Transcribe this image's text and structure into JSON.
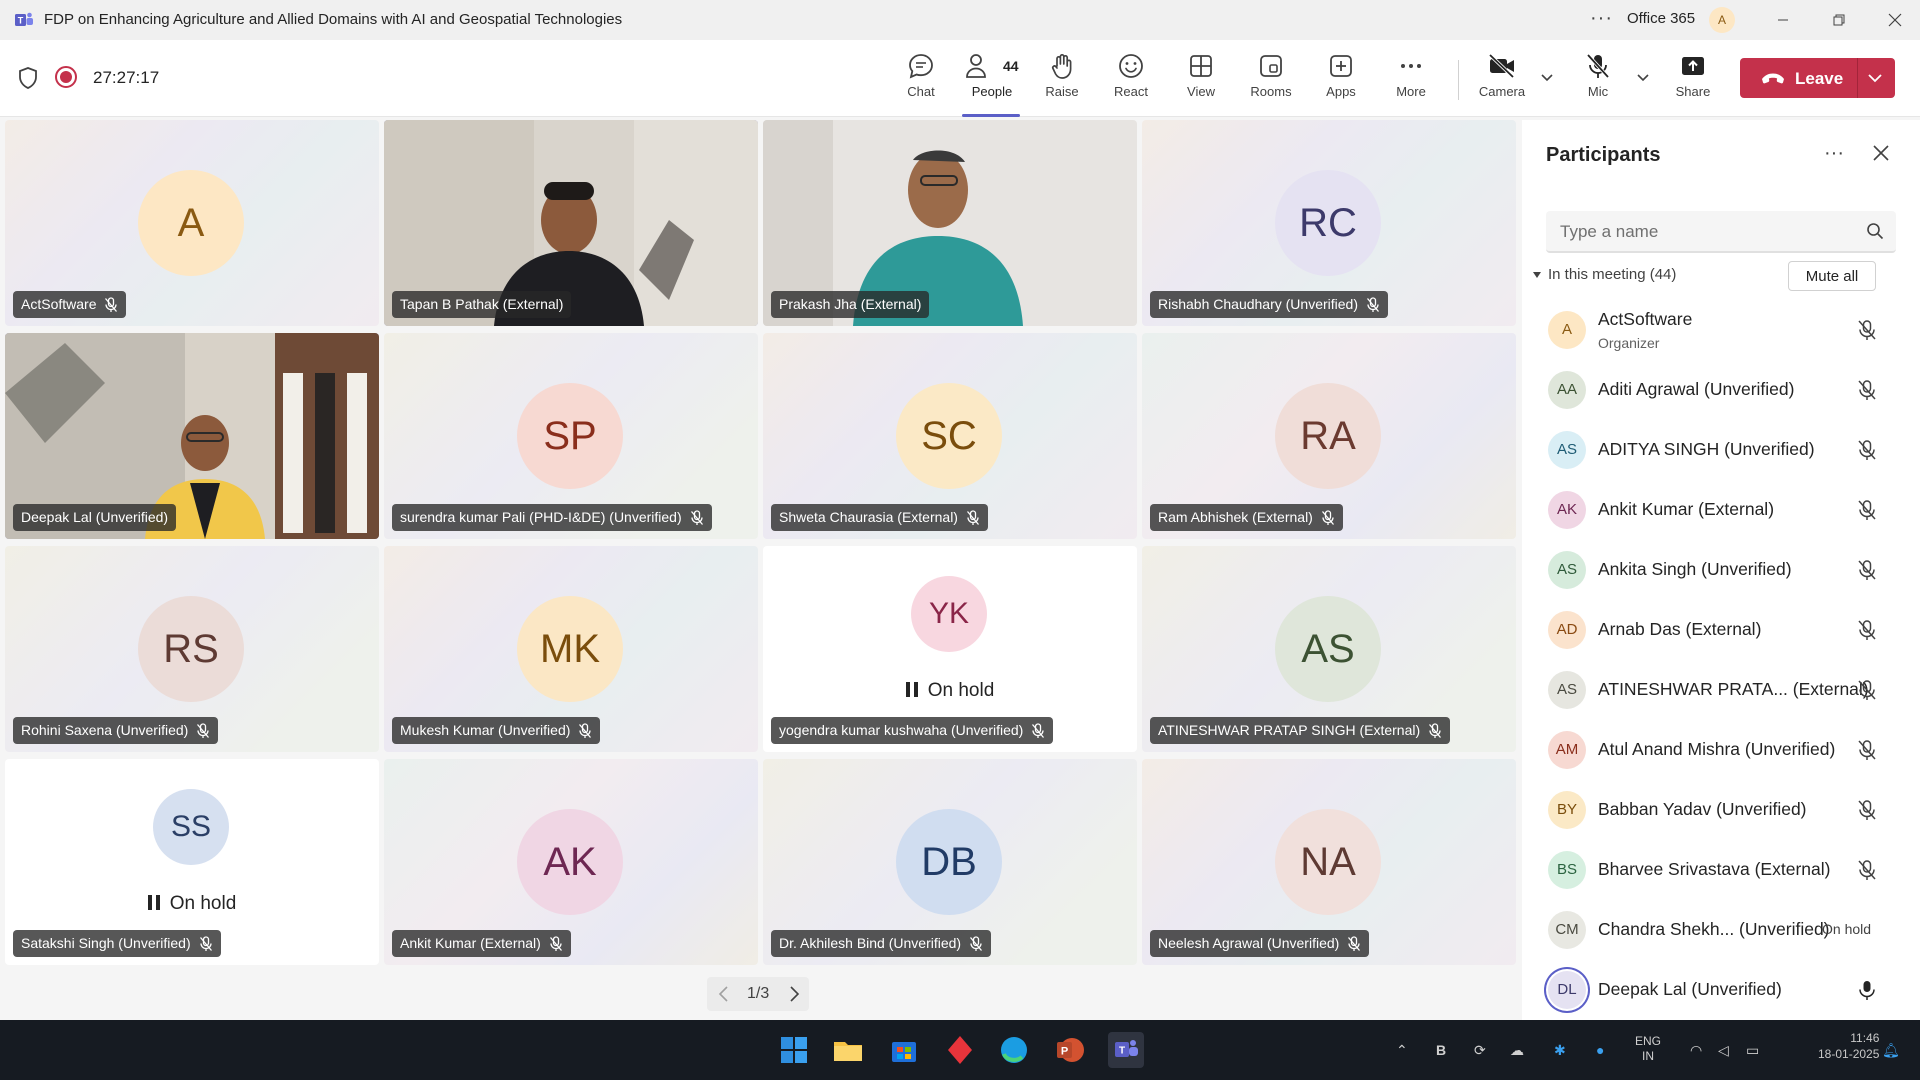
{
  "window": {
    "title": "FDP on Enhancing Agriculture and Allied Domains with AI and Geospatial Technologies",
    "more": "···",
    "org": "Office 365",
    "account_initial": "A"
  },
  "toolbar": {
    "timer": "27:27:17",
    "chat": "Chat",
    "people": "People",
    "people_count": "44",
    "raise": "Raise",
    "react": "React",
    "view": "View",
    "rooms": "Rooms",
    "apps": "Apps",
    "more": "More",
    "camera": "Camera",
    "mic": "Mic",
    "share": "Share",
    "leave": "Leave"
  },
  "tiles": [
    {
      "initials": "A",
      "name": "ActSoftware",
      "muted": true,
      "color": "#fde7c4",
      "text_color": "#8a5a12"
    },
    {
      "initials": "",
      "name": "Tapan B Pathak (External)",
      "muted": false,
      "video": true
    },
    {
      "initials": "",
      "name": "Prakash Jha (External)",
      "muted": false,
      "video": true
    },
    {
      "initials": "RC",
      "name": "Rishabh Chaudhary (Unverified)",
      "muted": true,
      "color": "#e5e2f2",
      "text_color": "#3d3a6b"
    },
    {
      "initials": "",
      "name": "Deepak Lal (Unverified)",
      "muted": false,
      "video": true
    },
    {
      "initials": "SP",
      "name": "surendra kumar Pali (PHD-I&DE) (Unverified)",
      "muted": true,
      "color": "#f7d9d2",
      "text_color": "#8a2e1c"
    },
    {
      "initials": "SC",
      "name": "Shweta Chaurasia (External)",
      "muted": true,
      "color": "#fbe9c6",
      "text_color": "#7a4d0c"
    },
    {
      "initials": "RA",
      "name": "Ram Abhishek (External)",
      "muted": true,
      "color": "#f0ddd8",
      "text_color": "#6b3a30"
    },
    {
      "initials": "RS",
      "name": "Rohini Saxena (Unverified)",
      "muted": true,
      "color": "#ebdcd8",
      "text_color": "#5e3a33"
    },
    {
      "initials": "MK",
      "name": "Mukesh Kumar (Unverified)",
      "muted": true,
      "color": "#fbe7c5",
      "text_color": "#7a4d0c"
    },
    {
      "initials": "YK",
      "name": "yogendra kumar kushwaha (Unverified)",
      "muted": true,
      "color": "#f8d7e0",
      "text_color": "#8a2548",
      "on_hold": "On hold"
    },
    {
      "initials": "AS",
      "name": "ATINESHWAR PRATAP SINGH (External)",
      "muted": true,
      "color": "#dfe6da",
      "text_color": "#3c5233"
    },
    {
      "initials": "SS",
      "name": "Satakshi Singh (Unverified)",
      "muted": true,
      "color": "#d6e0f0",
      "text_color": "#2b3f66",
      "on_hold": "On hold"
    },
    {
      "initials": "AK",
      "name": "Ankit Kumar (External)",
      "muted": true,
      "color": "#f0d6e4",
      "text_color": "#6e2752"
    },
    {
      "initials": "DB",
      "name": "Dr. Akhilesh Bind (Unverified)",
      "muted": true,
      "color": "#d0ddf0",
      "text_color": "#213b66"
    },
    {
      "initials": "NA",
      "name": "Neelesh Agrawal (Unverified)",
      "muted": true,
      "color": "#f1e0dc",
      "text_color": "#5e3a33"
    }
  ],
  "pager": {
    "label": "1/3"
  },
  "panel": {
    "title": "Participants",
    "more": "···",
    "search_placeholder": "Type a name",
    "section": "In this meeting (44)",
    "mute_all": "Mute all",
    "participants": [
      {
        "initials": "A",
        "name": "ActSoftware",
        "role": "Organizer",
        "color": "#fde7c4",
        "text_color": "#8a5a12"
      },
      {
        "initials": "AA",
        "name": "Aditi Agrawal (Unverified)",
        "color": "#dfe6da",
        "text_color": "#3c5233"
      },
      {
        "initials": "AS",
        "name": "ADITYA SINGH (Unverified)",
        "color": "#d9eef5",
        "text_color": "#1f5c74"
      },
      {
        "initials": "AK",
        "name": "Ankit Kumar (External)",
        "color": "#f0d6e4",
        "text_color": "#6e2752"
      },
      {
        "initials": "AS",
        "name": "Ankita Singh (Unverified)",
        "color": "#d6ebdc",
        "text_color": "#2f5a3a"
      },
      {
        "initials": "AD",
        "name": "Arnab Das (External)",
        "color": "#fbe3cd",
        "text_color": "#8a4a12"
      },
      {
        "initials": "AS",
        "name": "ATINESHWAR PRATA... (External)",
        "color": "#e6e6e0",
        "text_color": "#4a4a40"
      },
      {
        "initials": "AM",
        "name": "Atul Anand Mishra (Unverified)",
        "color": "#f7d9d2",
        "text_color": "#8a2e1c"
      },
      {
        "initials": "BY",
        "name": "Babban Yadav (Unverified)",
        "color": "#fbe9c6",
        "text_color": "#7a4d0c"
      },
      {
        "initials": "BS",
        "name": "Bharvee Srivastava (External)",
        "color": "#d6efe0",
        "text_color": "#2b6340"
      },
      {
        "initials": "CM",
        "name": "Chandra Shekh... (Unverified)",
        "color": "#e8e8e2",
        "text_color": "#4a4a40",
        "status": "On hold"
      },
      {
        "initials": "DL",
        "name": "Deepak Lal (Unverified)",
        "color": "#e5e2f2",
        "text_color": "#3d3a6b",
        "active": true
      }
    ]
  },
  "taskbar": {
    "lang_top": "ENG",
    "lang_bottom": "IN",
    "time": "11:46",
    "date": "18-01-2025"
  }
}
